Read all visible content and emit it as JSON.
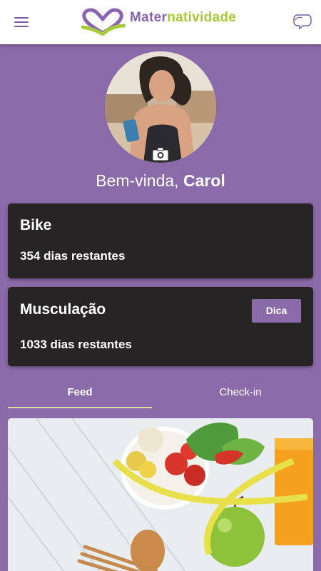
{
  "app": {
    "logo_text_part1": "Mater",
    "logo_text_part2": "natividade",
    "brand_purple": "#8a63b3",
    "brand_green": "#a8c93a"
  },
  "icons": {
    "menu": "hamburger-menu-icon",
    "chat": "chat-bubbles-icon",
    "camera": "camera-icon"
  },
  "profile": {
    "greeting_prefix": "Bem-vinda, ",
    "name": "Carol"
  },
  "activities": [
    {
      "title": "Bike",
      "remaining": "354 dias restantes"
    },
    {
      "title": "Musculação",
      "remaining": "1033 dias restantes",
      "tip_label": "Dica"
    }
  ],
  "tabs": [
    {
      "label": "Feed",
      "active": true
    },
    {
      "label": "Check-in",
      "active": false
    }
  ],
  "colors": {
    "background": "#8a6aa8",
    "card": "#262425",
    "tab_indicator": "#d6e0a0"
  }
}
